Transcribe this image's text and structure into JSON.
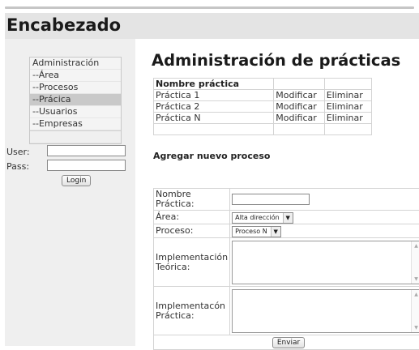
{
  "header": {
    "title": "Encabezado"
  },
  "sidebar": {
    "menu": [
      {
        "label": "Administración",
        "selected": false
      },
      {
        "label": "--Área",
        "selected": false
      },
      {
        "label": "--Procesos",
        "selected": false
      },
      {
        "label": "--Prácica",
        "selected": true
      },
      {
        "label": "--Usuarios",
        "selected": false
      },
      {
        "label": "--Empresas",
        "selected": false
      }
    ],
    "login": {
      "user_label": "User:",
      "pass_label": "Pass:",
      "button": "Login"
    }
  },
  "main": {
    "title": "Administración de prácticas",
    "table": {
      "header": "Nombre práctica",
      "rows": [
        {
          "name": "Práctica 1",
          "modify": "Modificar",
          "delete": "Eliminar"
        },
        {
          "name": "Práctica 2",
          "modify": "Modificar",
          "delete": "Eliminar"
        },
        {
          "name": "Práctica N",
          "modify": "Modificar",
          "delete": "Eliminar"
        }
      ]
    },
    "subtitle": "Agregar nuevo proceso",
    "form": {
      "name_label": "Nombre Práctica:",
      "area_label": "Área:",
      "area_value": "Alta dirección",
      "process_label": "Proceso:",
      "process_value": "Proceso N",
      "theory_label": "Implementación Teórica:",
      "practice_label": "Implementacón Práctica:",
      "submit": "Enviar"
    }
  }
}
